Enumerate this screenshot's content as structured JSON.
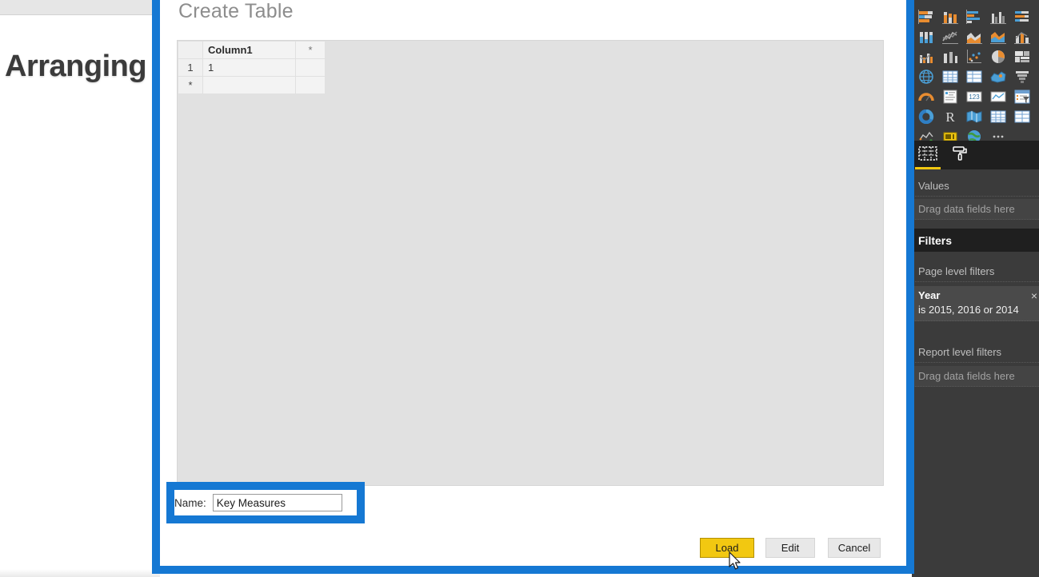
{
  "background": {
    "heading": "Arranging"
  },
  "dialog": {
    "title": "Create Table",
    "grid": {
      "corner": "",
      "column_header": "Column1",
      "new_column_marker": "*",
      "rows": [
        {
          "header": "1",
          "value": "1"
        },
        {
          "header": "*",
          "value": ""
        }
      ]
    },
    "name_label": "Name:",
    "name_value": "Key Measures",
    "name_placeholder": "",
    "buttons": {
      "load": "Load",
      "edit": "Edit",
      "cancel": "Cancel"
    }
  },
  "right_panel": {
    "visualizations": [
      "stacked-bar-chart-icon",
      "stacked-column-chart-icon",
      "clustered-bar-chart-icon",
      "clustered-column-chart-icon",
      "100-stacked-bar-chart-icon",
      "100-stacked-column-chart-icon",
      "line-chart-icon",
      "area-chart-icon",
      "stacked-area-chart-icon",
      "line-stacked-column-chart-icon",
      "line-clustered-column-chart-icon",
      "ribbon-chart-icon",
      "scatter-chart-icon",
      "pie-chart-icon",
      "treemap-icon",
      "map-icon",
      "table-icon",
      "matrix-icon",
      "filled-map-icon",
      "funnel-icon",
      "gauge-icon",
      "multi-row-card-icon",
      "card-icon",
      "kpi-icon",
      "slicer-icon",
      "donut-chart-icon",
      "r-script-visual-icon",
      "shape-map-icon",
      "matrix-grid-icon",
      "table-grid-icon",
      "waterfall-chart-icon",
      "key-influencers-icon",
      "globe-map-icon",
      "more-options-icon"
    ],
    "tabs": [
      {
        "name": "fields-tab",
        "icon": "fields-grid-icon",
        "active": true
      },
      {
        "name": "format-tab",
        "icon": "paint-roller-icon",
        "active": false
      }
    ],
    "values_label": "Values",
    "values_drop": "Drag data fields here",
    "filters_header": "Filters",
    "page_level_filters_label": "Page level filters",
    "filter_card": {
      "field": "Year",
      "condition": "is 2015, 2016 or 2014",
      "close": "×"
    },
    "report_level_filters_label": "Report level filters",
    "report_level_drop": "Drag data fields here"
  },
  "colors": {
    "highlight_blue": "#1578d3",
    "powerbi_yellow": "#f2c811",
    "panel_dark": "#3b3b3b",
    "panel_darker": "#1f1f1f"
  }
}
